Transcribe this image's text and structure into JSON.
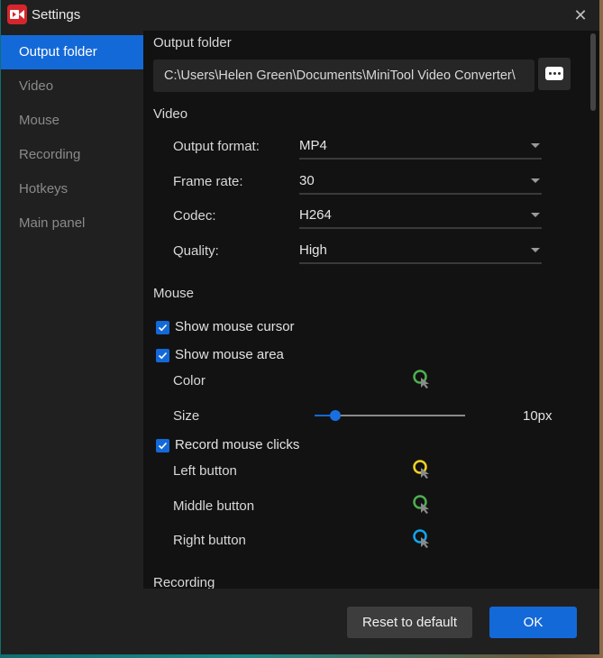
{
  "window": {
    "title": "Settings",
    "app_icon": "video-recorder-icon",
    "close_icon": "close-icon"
  },
  "sidebar": {
    "items": [
      {
        "label": "Output folder",
        "active": true
      },
      {
        "label": "Video",
        "active": false
      },
      {
        "label": "Mouse",
        "active": false
      },
      {
        "label": "Recording",
        "active": false
      },
      {
        "label": "Hotkeys",
        "active": false
      },
      {
        "label": "Main panel",
        "active": false
      }
    ]
  },
  "output_folder": {
    "title": "Output folder",
    "path": "C:\\Users\\Helen Green\\Documents\\MiniTool Video Converter\\",
    "browse_icon": "more-icon"
  },
  "video": {
    "title": "Video",
    "fields": [
      {
        "label": "Output format:",
        "value": "MP4"
      },
      {
        "label": "Frame rate:",
        "value": "30"
      },
      {
        "label": "Codec:",
        "value": "H264"
      },
      {
        "label": "Quality:",
        "value": "High"
      }
    ]
  },
  "mouse": {
    "title": "Mouse",
    "show_cursor": {
      "label": "Show mouse cursor",
      "checked": true
    },
    "show_area": {
      "label": "Show mouse area",
      "checked": true
    },
    "color": {
      "label": "Color",
      "value": "#4caf50"
    },
    "size": {
      "label": "Size",
      "value": "10px",
      "fraction": 0.14
    },
    "record_clicks": {
      "label": "Record mouse clicks",
      "checked": true
    },
    "buttons": [
      {
        "label": "Left button",
        "color": "#f5d020"
      },
      {
        "label": "Middle button",
        "color": "#4caf50"
      },
      {
        "label": "Right button",
        "color": "#11a4ee"
      }
    ]
  },
  "recording": {
    "title": "Recording"
  },
  "footer": {
    "reset_label": "Reset to default",
    "ok_label": "OK"
  },
  "colors": {
    "accent": "#1469d8",
    "panel": "#121212",
    "chrome": "#202020"
  }
}
